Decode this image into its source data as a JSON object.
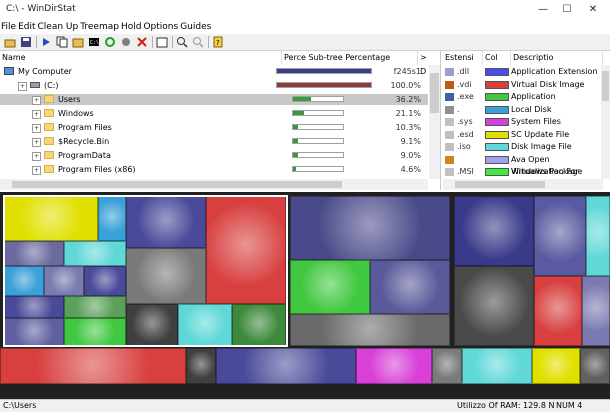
{
  "window": {
    "title": "C:\\ - WinDirStat",
    "min": "—",
    "max": "☐",
    "close": "✕"
  },
  "menu": [
    "File",
    "Edit",
    "Clean Up",
    "Treemap",
    "Hold",
    "Options",
    "Guides"
  ],
  "toolbar_icons": [
    "open-icon",
    "save-icon",
    "play-icon",
    "copy-icon",
    "explorer-icon",
    "cmd-icon",
    "refresh-icon",
    "delete-icon",
    "properties-icon",
    "zoom-in-icon",
    "zoom-out-icon",
    "help-icon"
  ],
  "tree": {
    "headers": {
      "name": "Name",
      "percentage": "Perce Sub-tree Percentage",
      "extra": "> D"
    },
    "rows": [
      {
        "name": "My Computer",
        "pct": "f245s1",
        "fill": 100,
        "fillcolor": "#3b3b8f",
        "indent": 0,
        "icon": "computer-icon"
      },
      {
        "name": "(C:)",
        "pct": "100.0%",
        "fill": 100,
        "fillcolor": "#8f3b3b",
        "indent": 1,
        "icon": "drive-icon"
      },
      {
        "name": "Users",
        "pct": "36.2%",
        "fill": 36,
        "fillcolor": "#3c9a3c",
        "indent": 2,
        "icon": "folder-icon"
      },
      {
        "name": "Windows",
        "pct": "21.1%",
        "fill": 21,
        "fillcolor": "#3c9a3c",
        "indent": 2,
        "icon": "folder-icon"
      },
      {
        "name": "Program Files",
        "pct": "10.3%",
        "fill": 10,
        "fillcolor": "#3c9a3c",
        "indent": 2,
        "icon": "folder-icon"
      },
      {
        "name": "$Recycle.Bin",
        "pct": "9.1%",
        "fill": 9,
        "fillcolor": "#3c9a3c",
        "indent": 2,
        "icon": "folder-icon"
      },
      {
        "name": "ProgramData",
        "pct": "9.0%",
        "fill": 9,
        "fillcolor": "#3c9a3c",
        "indent": 2,
        "icon": "folder-icon"
      },
      {
        "name": "Program Files (x86)",
        "pct": "4.6%",
        "fill": 5,
        "fillcolor": "#3c9a3c",
        "indent": 2,
        "icon": "folder-icon"
      }
    ],
    "selected_index": 2
  },
  "extensions": {
    "headers": {
      "ext": "Estensi",
      "color": "Col",
      "desc": "Descriptio"
    },
    "rows": [
      {
        "ext": ".dll",
        "color": "#4a4ae8",
        "desc": "Application Extension",
        "icon_color": "#9aa0c8"
      },
      {
        "ext": ".vdi",
        "color": "#d84040",
        "desc": "Virtual Disk Image",
        "icon_color": "#c05a10"
      },
      {
        "ext": ".exe",
        "color": "#40c840",
        "desc": "Application",
        "icon_color": "#4060a0"
      },
      {
        "ext": ".",
        "color": "#3aa0d8",
        "desc": "Local Disk",
        "icon_color": "#909090"
      },
      {
        "ext": ".sys",
        "color": "#d840d8",
        "desc": "System Files",
        "icon_color": "#c0c0c0"
      },
      {
        "ext": ".esd",
        "color": "#e0e000",
        "desc": "SC Update File",
        "icon_color": "#c0c0c0"
      },
      {
        "ext": ".iso",
        "color": "#60d8d8",
        "desc": "Disk Image File",
        "icon_color": "#c0c0c0"
      },
      {
        "ext": "",
        "color": "#a0a0f0",
        "desc": "Ava Open Virtualization For",
        "icon_color": "#d08020"
      },
      {
        "ext": ".MSI",
        "color": "#40e840",
        "desc": "Windows Package",
        "icon_color": "#c0c0c0"
      }
    ]
  },
  "statusbar": {
    "path": "C:\\Users",
    "ram": "Utilizzo Of RAM: 129.8 N",
    "num": "NUM 4"
  },
  "colors": {
    "selection": "#c8c8c8",
    "treemap_bg": "#202020",
    "highlight_border": "#ffffff"
  }
}
